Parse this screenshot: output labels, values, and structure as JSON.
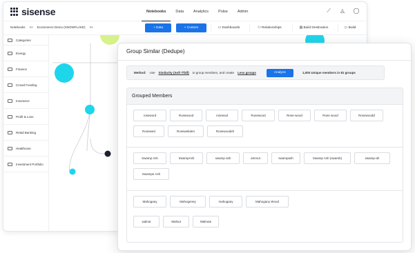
{
  "app": {
    "logo_text": "sisense",
    "nav": [
      "Notebooks",
      "Data",
      "Analytics",
      "Pulse",
      "Admin"
    ],
    "active_nav": "Notebooks",
    "breadcrumb": [
      "Notebooks",
      ">>",
      "Ecommerce Demo (SNOWFLAKE)",
      ">>"
    ],
    "toolbar": {
      "data_label": "+ Data",
      "custom_label": "+ Custom",
      "dashboards_label": "Dashboards",
      "relationships_label": "Relationships",
      "build_destination_label": "Build Destination",
      "build_label": "Build"
    },
    "sidebar": {
      "items": [
        "Categories",
        "Energy",
        "Finance",
        "Crowd Funding",
        "Insurance",
        "Profit & Loss",
        "Retail Banking",
        "Healthcare",
        "Investment Portfolio"
      ]
    }
  },
  "modal": {
    "title": "Group Similar (Dedupe)",
    "method": {
      "label": "Method:",
      "use_text": "Use",
      "algorithm": "Similarity (Soft Tfidf)",
      "middle_text": "to group members, and create",
      "groups_link": "Less groups",
      "analyze_label": "Analyze",
      "summary": "1,000 Unique members in 81 groups"
    },
    "grouped_members_title": "Grouped Members",
    "groups": [
      [
        "roseword",
        "Rosewood",
        "rosewod",
        "Rusewood",
        "Rose-wood",
        "Rose wood",
        "Rosewoodd",
        "Rosewed",
        "Rosewekden",
        "Rosewoodeh"
      ],
      [
        "Swamp Ash",
        "SwampAsh",
        "swamp ash",
        "ammut",
        "swampash",
        "Swamp Ash (swamb)",
        "swamp-ah",
        "Swampe Ash"
      ],
      [
        "Mahogany",
        "Mahogeney",
        "mahogany",
        "Mahogany Wood",
        "walnut",
        "Walnut",
        "Walnute"
      ]
    ]
  },
  "colors": {
    "accent_blue": "#1a73e8",
    "circle_cyan": "#1ed6ec",
    "circle_lime": "#d6f38a",
    "dot_black": "#1d2130"
  }
}
